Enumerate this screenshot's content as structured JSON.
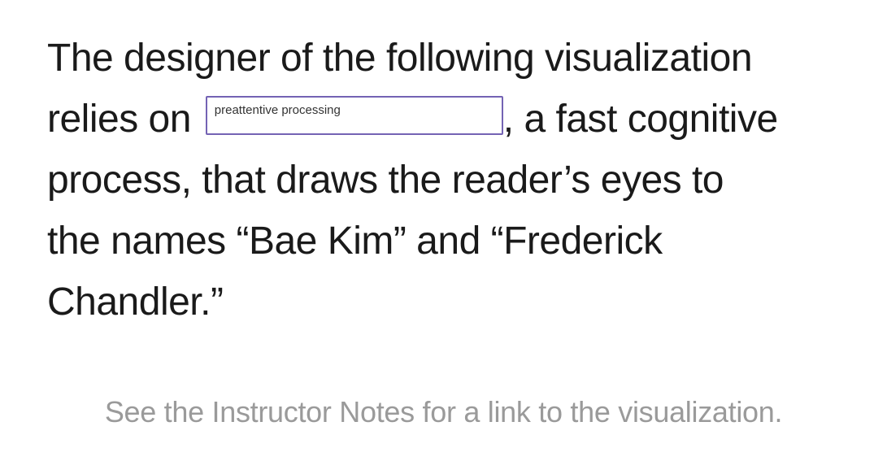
{
  "question": {
    "line1": "The designer of the following visualization",
    "line2_before": "relies on",
    "blank_value": "preattentive processing",
    "line2_after": ", a fast cognitive",
    "line3": "process, that draws the reader’s eyes to",
    "line4": "the names “Bae Kim” and “Frederick",
    "line5": "Chandler.”"
  },
  "note": "See the Instructor Notes for a link to the visualization.",
  "colors": {
    "input_border": "#7463b4",
    "note_text": "#9a9a9a",
    "body_text": "#1a1a1a"
  }
}
